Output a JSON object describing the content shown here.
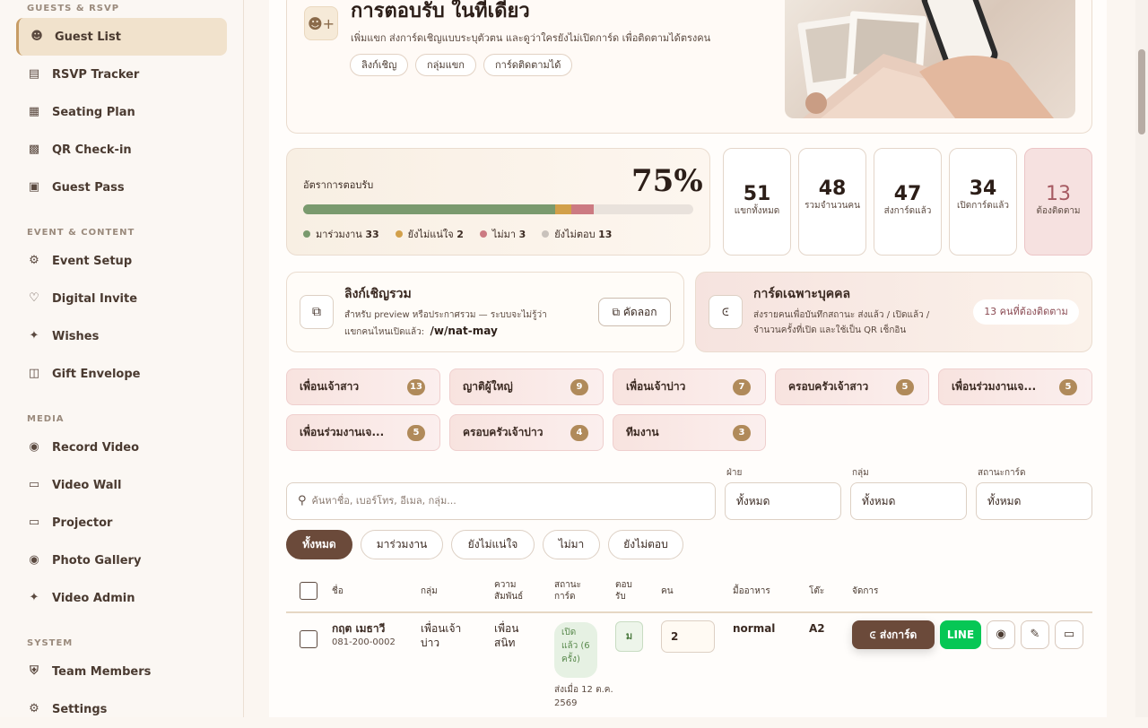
{
  "sidebar": {
    "sections": [
      {
        "label": "GUESTS & RSVP"
      },
      {
        "label": "EVENT & CONTENT"
      },
      {
        "label": "MEDIA"
      },
      {
        "label": "SYSTEM"
      }
    ],
    "items": [
      {
        "label": "Guest List",
        "icon": "users-icon"
      },
      {
        "label": "RSVP Tracker",
        "icon": "clipboard-icon"
      },
      {
        "label": "Seating Plan",
        "icon": "table-layout-icon"
      },
      {
        "label": "QR Check-in",
        "icon": "qr-code-icon"
      },
      {
        "label": "Guest Pass",
        "icon": "ticket-icon"
      },
      {
        "label": "Event Setup",
        "icon": "gear-icon"
      },
      {
        "label": "Digital Invite",
        "icon": "heart-icon"
      },
      {
        "label": "Wishes",
        "icon": "sparkles-icon"
      },
      {
        "label": "Gift Envelope",
        "icon": "gift-icon"
      },
      {
        "label": "Record Video",
        "icon": "camera-icon"
      },
      {
        "label": "Video Wall",
        "icon": "tv-icon"
      },
      {
        "label": "Projector",
        "icon": "tv-icon"
      },
      {
        "label": "Photo Gallery",
        "icon": "camera-icon"
      },
      {
        "label": "Video Admin",
        "icon": "sparkles-icon"
      },
      {
        "label": "Team Members",
        "icon": "shield-icon"
      },
      {
        "label": "Settings",
        "icon": "gear-icon"
      }
    ]
  },
  "hero": {
    "title": "การตอบรับ ในที่เดียว",
    "subtitle": "เพิ่มแขก ส่งการ์ดเชิญแบบระบุตัวตน และดูว่าใครยังไม่เปิดการ์ด เพื่อติดตามได้ตรงคน",
    "chips": [
      "ลิงก์เชิญ",
      "กลุ่มแขก",
      "การ์ดติดตามได้"
    ]
  },
  "rate": {
    "label": "อัตราการตอบรับ",
    "value": "75%",
    "bar": {
      "attend": 33,
      "unsure": 2,
      "decline": 3,
      "none": 13
    },
    "legend": [
      {
        "label": "มาร่วมงาน",
        "count": "33",
        "color": "#7a9a6e"
      },
      {
        "label": "ยังไม่แน่ใจ",
        "count": "2",
        "color": "#d2a04a"
      },
      {
        "label": "ไม่มา",
        "count": "3",
        "color": "#cc7a82"
      },
      {
        "label": "ยังไม่ตอบ",
        "count": "13",
        "color": "#c9c2bc"
      }
    ]
  },
  "stats": [
    {
      "n": "51",
      "l": "แขกทั้งหมด"
    },
    {
      "n": "48",
      "l": "รวมจำนวนคน"
    },
    {
      "n": "47",
      "l": "ส่งการ์ดแล้ว"
    },
    {
      "n": "34",
      "l": "เปิดการ์ดแล้ว"
    },
    {
      "n": "13",
      "l": "ต้องติดตาม"
    }
  ],
  "link": {
    "title": "ลิงก์เชิญรวม",
    "desc1": "สำหรับ preview หรือประกาศรวม — ระบบจะไม่รู้ว่า",
    "desc2": "แขกคนไหนเปิดแล้ว:",
    "path": "/w/nat-may",
    "copy": "คัดลอก"
  },
  "personal": {
    "title": "การ์ดเฉพาะบุคคล",
    "desc1": "ส่งรายคนเพื่อบันทึกสถานะ ส่งแล้ว / เปิดแล้ว /",
    "desc2": "จำนวนครั้งที่เปิด และใช้เป็น QR เช็กอิน",
    "badge": "13 คนที่ต้องติดตาม"
  },
  "groups": [
    {
      "name": "เพื่อนเจ้าสาว",
      "count": "13"
    },
    {
      "name": "ญาติผู้ใหญ่",
      "count": "9"
    },
    {
      "name": "เพื่อนเจ้าบ่าว",
      "count": "7"
    },
    {
      "name": "ครอบครัวเจ้าสาว",
      "count": "5"
    },
    {
      "name": "เพื่อนร่วมงานเจ...",
      "count": "5"
    },
    {
      "name": "เพื่อนร่วมงานเจ...",
      "count": "5"
    },
    {
      "name": "ครอบครัวเจ้าบ่าว",
      "count": "4"
    },
    {
      "name": "ทีมงาน",
      "count": "3"
    }
  ],
  "filters": {
    "search_placeholder": "ค้นหาชื่อ, เบอร์โทร, อีเมล, กลุ่ม...",
    "side_label": "ฝ่าย",
    "side_value": "ทั้งหมด",
    "group_label": "กลุ่ม",
    "group_value": "ทั้งหมด",
    "status_label": "สถานะการ์ด",
    "status_value": "ทั้งหมด"
  },
  "tabs": [
    "ทั้งหมด",
    "มาร่วมงาน",
    "ยังไม่แน่ใจ",
    "ไม่มา",
    "ยังไม่ตอบ"
  ],
  "table": {
    "headers": {
      "name": "ชื่อ",
      "group": "กลุ่ม",
      "rel": "ความ\nสัมพันธ์",
      "status": "สถานะ\nการ์ด",
      "rsvp": "ตอบ\nรับ",
      "people": "คน",
      "food": "มื้ออาหาร",
      "tbl": "โต๊ะ",
      "manage": "จัดการ"
    },
    "row": {
      "name": "กฤต เมธาวี",
      "phone": "081-200-0002",
      "group": "เพื่อนเจ้าบ่าว",
      "rel": "เพื่อนสนิท",
      "status": "เปิดแล้ว (6 ครั้ง)",
      "sent": "ส่งเมื่อ 12 ต.ค. 2569",
      "rsvp": "ม",
      "people": "2",
      "food": "normal",
      "tbl": "A2",
      "send": "ส่งการ์ด",
      "line": "LINE"
    }
  }
}
